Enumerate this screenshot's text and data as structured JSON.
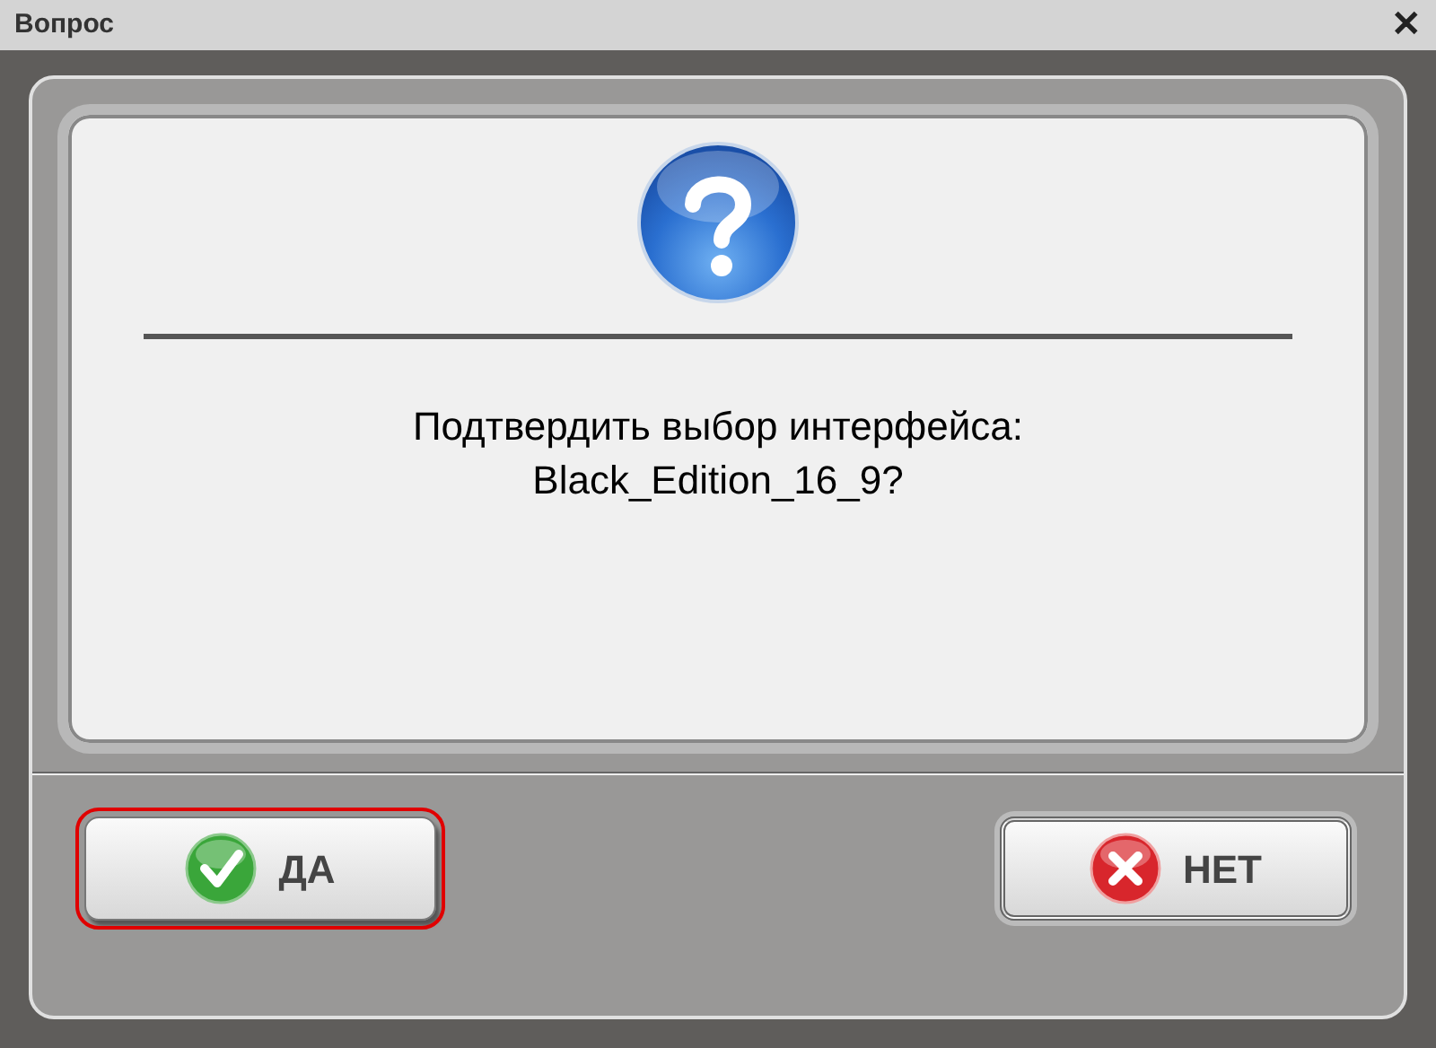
{
  "window": {
    "title": "Вопрос",
    "close": "✕"
  },
  "message": {
    "lines": [
      "Подтвердить выбор интерфейса:",
      "Black_Edition_16_9?"
    ]
  },
  "buttons": [
    {
      "label": "ДА",
      "kind": "yes",
      "selected": true
    },
    {
      "label": "НЕТ",
      "kind": "no",
      "selected": false
    }
  ]
}
